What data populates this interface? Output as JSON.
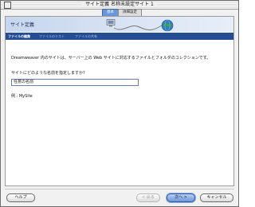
{
  "window": {
    "title": "サイト定義 名称未設定サイト 1"
  },
  "tabs": [
    {
      "label": "基本",
      "active": true
    },
    {
      "label": "詳細設定",
      "active": false
    }
  ],
  "header": {
    "title": "サイト定義"
  },
  "steps": [
    {
      "label": "ファイルの編集",
      "active": true
    },
    {
      "label": "ファイルのテスト",
      "active": false
    },
    {
      "label": "ファイルの共有",
      "active": false
    }
  ],
  "content": {
    "description": "Dreamweaver 内のサイトは、サーバー上の Web サイトに対応するファイルとフォルダのコレクションです。",
    "question": "サイトにどのような名前を指定しますか?",
    "site_name_value": "任意の名前",
    "example": "例 : MySite"
  },
  "buttons": {
    "help": "ヘルプ",
    "back": "< 戻る",
    "next": "次へ >",
    "cancel": "キャンセル"
  },
  "colors": {
    "step_bar": "#244d96",
    "primary_button": "#6f97d8",
    "header_gradient": "#c6d6ee"
  }
}
